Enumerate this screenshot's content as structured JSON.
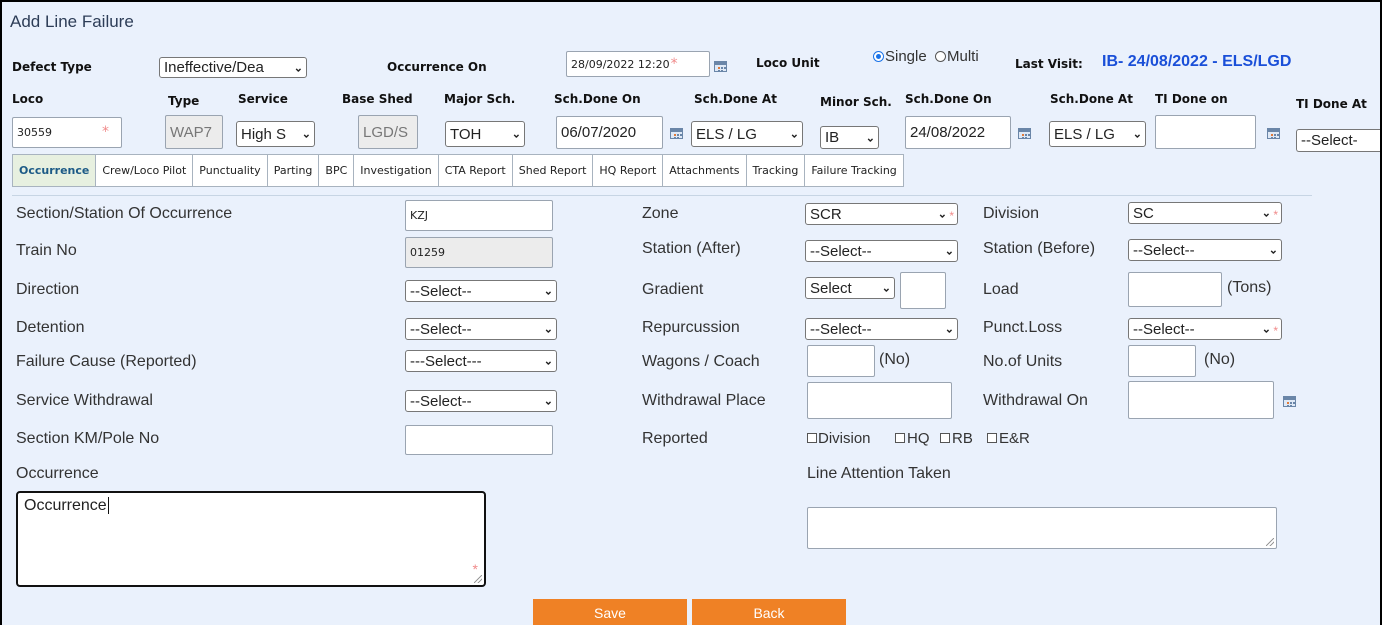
{
  "page_title": "Add Line Failure",
  "header": {
    "defect_type_label": "Defect Type",
    "defect_type_value": "Ineffective/Dea",
    "occurrence_on_label": "Occurrence On",
    "occurrence_on_value": "28/09/2022 12:20",
    "loco_unit_label": "Loco Unit",
    "loco_unit_options": [
      "Single",
      "Multi"
    ],
    "loco_unit_selected": "Single",
    "last_visit_label": "Last Visit:",
    "last_visit_value": "IB- 24/08/2022 - ELS/LGD"
  },
  "loco_row": {
    "labels": {
      "loco": "Loco",
      "type": "Type",
      "service": "Service",
      "base_shed": "Base Shed",
      "major_sch": "Major Sch.",
      "sch_done_on": "Sch.Done On",
      "sch_done_at": "Sch.Done At",
      "minor_sch": "Minor Sch.",
      "sch_done_on2": "Sch.Done On",
      "sch_done_at2": "Sch.Done At",
      "ti_done_on": "TI Done on",
      "ti_done_at": "TI Done At"
    },
    "values": {
      "loco": "30559",
      "type": "WAP7",
      "service": "High S",
      "base_shed": "LGD/S",
      "major_sch": "TOH",
      "sch_done_on": "06/07/2020",
      "sch_done_at": "ELS / LG",
      "minor_sch": "IB",
      "sch_done_on2": "24/08/2022",
      "sch_done_at2": "ELS / LG",
      "ti_done_on": "",
      "ti_done_at": "--Select-"
    }
  },
  "tabs": [
    {
      "label": "Occurrence",
      "active": true
    },
    {
      "label": "Crew/Loco Pilot"
    },
    {
      "label": "Punctuality"
    },
    {
      "label": "Parting"
    },
    {
      "label": "BPC"
    },
    {
      "label": "Investigation"
    },
    {
      "label": "CTA Report"
    },
    {
      "label": "Shed Report"
    },
    {
      "label": "HQ Report"
    },
    {
      "label": "Attachments"
    },
    {
      "label": "Tracking"
    },
    {
      "label": "Failure Tracking"
    }
  ],
  "form": {
    "section_station_label": "Section/Station Of Occurrence",
    "section_station_value": "KZJ",
    "train_no_label": "Train No",
    "train_no_value": "01259",
    "direction_label": "Direction",
    "direction_value": "--Select--",
    "detention_label": "Detention",
    "detention_value": "--Select--",
    "failure_cause_label": "Failure Cause (Reported)",
    "failure_cause_value": "---Select---",
    "service_withdrawal_label": "Service Withdrawal",
    "service_withdrawal_value": "--Select--",
    "section_km_label": "Section KM/Pole No",
    "section_km_value": "",
    "occurrence_label": "Occurrence",
    "occurrence_value": "Occurrence",
    "zone_label": "Zone",
    "zone_value": "SCR",
    "station_after_label": "Station (After)",
    "station_after_value": "--Select--",
    "gradient_label": "Gradient",
    "gradient_value": "Select",
    "repurcussion_label": "Repurcussion",
    "repurcussion_value": "--Select--",
    "wagons_label": "Wagons / Coach",
    "wagons_unit": "(No)",
    "withdrawal_place_label": "Withdrawal Place",
    "reported_label": "Reported",
    "reported_options": [
      "Division",
      "HQ",
      "RB",
      "E&R"
    ],
    "line_attention_label": "Line Attention Taken",
    "division_label": "Division",
    "division_value": "SC",
    "station_before_label": "Station (Before)",
    "station_before_value": "--Select--",
    "load_label": "Load",
    "load_unit": "(Tons)",
    "punct_loss_label": "Punct.Loss",
    "punct_loss_value": "--Select--",
    "no_of_units_label": "No.of Units",
    "no_of_units_unit": "(No)",
    "withdrawal_on_label": "Withdrawal On"
  },
  "actions": {
    "save_label": "Save",
    "back_label": "Back"
  },
  "colors": {
    "background": "#eaf1fc",
    "accent_orange": "#ef8125",
    "last_visit_blue": "#1a4fd8",
    "required_mark": "#f08a8a"
  }
}
